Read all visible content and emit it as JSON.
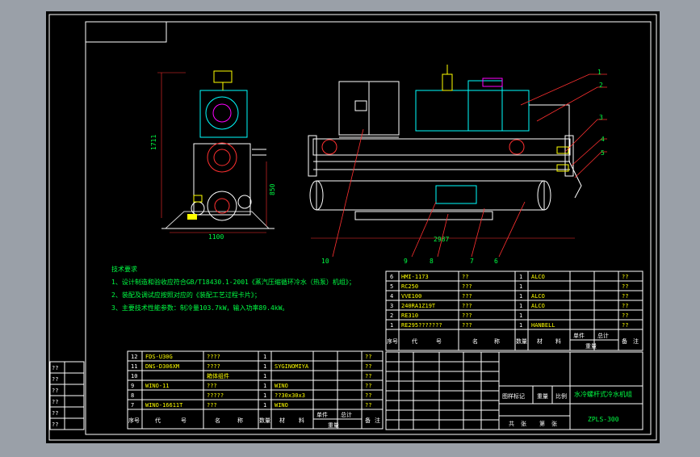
{
  "technical_requirements": {
    "heading": "技术要求",
    "items": [
      "1、设计制造和验收应符合GB/T18430.1-2001《蒸汽压缩循环冷水（热泵）机组》；",
      "2、装配及调试应按照对应的《装配工艺过程卡片》；",
      "3、主要技术性能参数：制冷量103.7kW，输入功率89.4kW。"
    ]
  },
  "dimensions": {
    "height_side": "1711",
    "height_lower": "850",
    "width_side": "1100",
    "length_front": "2987"
  },
  "balloons": [
    "1",
    "2",
    "3",
    "4",
    "5",
    "6",
    "7",
    "8",
    "9",
    "10"
  ],
  "parts_upper": {
    "rows": [
      {
        "no": "6",
        "code": "HMI-1173",
        "name": "??",
        "qty": "1",
        "material": "ALCO",
        "note": "??"
      },
      {
        "no": "5",
        "code": "RC250",
        "name": "???",
        "qty": "1",
        "material": "",
        "note": "??"
      },
      {
        "no": "4",
        "code": "VVE100",
        "name": "???",
        "qty": "1",
        "material": "ALCO",
        "note": "??"
      },
      {
        "no": "3",
        "code": "240RA1Z19T",
        "name": "???",
        "qty": "1",
        "material": "ALCO",
        "note": "??"
      },
      {
        "no": "2",
        "code": "RE310",
        "name": "???",
        "qty": "1",
        "material": "",
        "note": "??"
      },
      {
        "no": "1",
        "code": "RE295???????",
        "name": "???",
        "qty": "1",
        "material": "HANBELL",
        "note": "??"
      }
    ],
    "header": {
      "no": "序号",
      "code": "代",
      "code2": "号",
      "name": "名",
      "name2": "称",
      "qty": "数量",
      "material": "材",
      "material2": "料",
      "single": "单件",
      "total": "总计",
      "weight": "重量",
      "note": "备",
      "note2": "注"
    }
  },
  "parts_lower": {
    "rows": [
      {
        "no": "12",
        "code": "FDS-U30G",
        "name": "????",
        "qty": "1",
        "material": "",
        "note": "??"
      },
      {
        "no": "11",
        "code": "DNS-D306XM",
        "name": "????",
        "qty": "1",
        "material": "SYGINOMIYA",
        "note": "??"
      },
      {
        "no": "10",
        "code": "",
        "name": "箱体组件",
        "qty": "1",
        "material": "",
        "note": "??"
      },
      {
        "no": "9",
        "code": "WINO-11",
        "name": "???",
        "qty": "1",
        "material": "WINO",
        "note": "??"
      },
      {
        "no": "8",
        "code": "",
        "name": "?????",
        "qty": "1",
        "material": "??30x30x3",
        "note": "??"
      },
      {
        "no": "7",
        "code": "WINO-16611T",
        "name": "???",
        "qty": "1",
        "material": "WINO",
        "note": "??"
      }
    ],
    "header": {
      "no": "序号",
      "code": "代",
      "code2": "号",
      "name": "名",
      "name2": "称",
      "qty": "数量",
      "material": "材",
      "material2": "料",
      "single": "单件",
      "total": "总计",
      "weight": "重量",
      "note": "备",
      "note2": "注"
    }
  },
  "title_block": {
    "product": "水冷螺杆式冷水机组",
    "drawing_no": "ZPLS-300",
    "scale_label": "图样标记",
    "weight_label": "重量",
    "ratio_label": "比例",
    "sheet_total": "共",
    "sheet_label": "张",
    "sheet_no": "第",
    "sheet_label2": "张"
  },
  "side_stamps": [
    "??",
    "??",
    "??",
    "??",
    "??",
    "??"
  ],
  "colors": {
    "background": "#000000",
    "border": "#ffffff",
    "leader": "#ff0000",
    "text": "#00ff44",
    "part": "#00ffff",
    "accent": "#ff00ff",
    "table_text": "#ffff00"
  }
}
